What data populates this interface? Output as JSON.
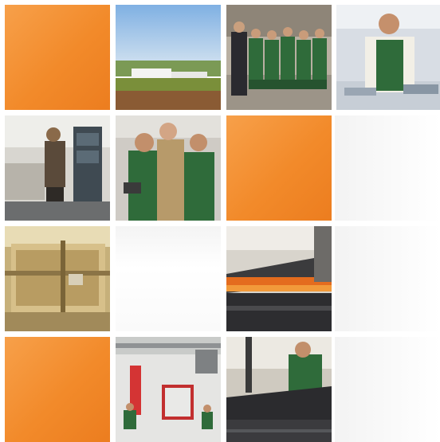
{
  "tiles": [
    {
      "name": "tile-orange-1",
      "kind": "orange"
    },
    {
      "name": "photo-landscape-building",
      "kind": "photo"
    },
    {
      "name": "photo-group-workers",
      "kind": "photo"
    },
    {
      "name": "photo-worker-apron",
      "kind": "photo"
    },
    {
      "name": "photo-lab-worker",
      "kind": "photo"
    },
    {
      "name": "photo-three-men",
      "kind": "photo"
    },
    {
      "name": "tile-orange-2",
      "kind": "orange"
    },
    {
      "name": "photo-cutting-machine",
      "kind": "photo"
    },
    {
      "name": "tile-blank",
      "kind": "blank"
    },
    {
      "name": "photo-press-brake",
      "kind": "photo"
    },
    {
      "name": "tile-orange-3",
      "kind": "orange"
    },
    {
      "name": "photo-factory-floor",
      "kind": "photo"
    },
    {
      "name": "photo-worker-sheet-metal",
      "kind": "photo"
    }
  ],
  "colors": {
    "orange": "#f28a2a",
    "uniform_green": "#2f6b3a",
    "sky": "#8fb7e0",
    "grass": "#6b8a3a"
  }
}
